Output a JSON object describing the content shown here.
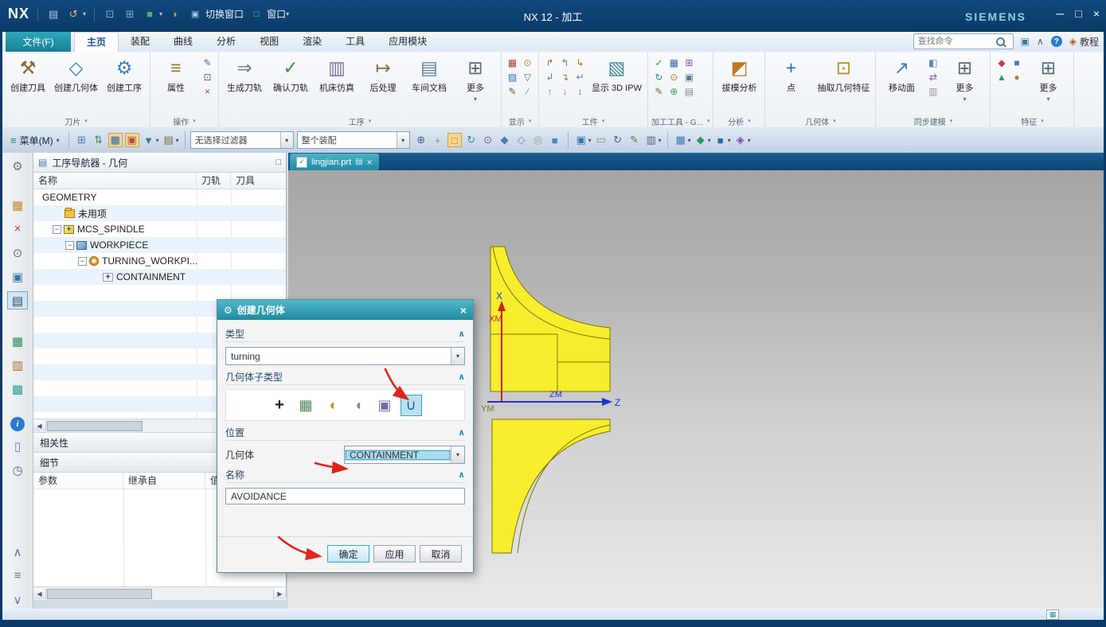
{
  "titlebar": {
    "logo": "NX",
    "switch_window": "切换窗口",
    "window_menu": "窗口",
    "title": "NX 12 - 加工",
    "brand": "SIEMENS"
  },
  "tabs": {
    "file": "文件(F)",
    "items": [
      "主页",
      "装配",
      "曲线",
      "分析",
      "视图",
      "渲染",
      "工具",
      "应用模块"
    ],
    "active_index": 0,
    "search_placeholder": "查找命令",
    "tutorial": "教程"
  },
  "ribbon": {
    "groups": [
      {
        "label": "刀片",
        "items": [
          {
            "kind": "lg",
            "name": "create-tool-button",
            "label": "创建刀具",
            "glyph": "⚒",
            "fg": "#8a6a3a"
          },
          {
            "kind": "lg",
            "name": "create-geometry-button",
            "label": "创建几何体",
            "glyph": "◇",
            "fg": "#2a7ab0"
          },
          {
            "kind": "lg",
            "name": "create-operation-button",
            "label": "创建工序",
            "glyph": "⚙",
            "fg": "#4a7ab0"
          }
        ]
      },
      {
        "label": "操作",
        "items": [
          {
            "kind": "lg",
            "name": "properties-button",
            "label": "属性",
            "glyph": "≡",
            "fg": "#9a7a30"
          },
          {
            "kind": "grid",
            "cols": 1,
            "icons": [
              {
                "name": "edit-operation-icon",
                "glyph": "✎",
                "fg": "#4a6a9a"
              },
              {
                "name": "copy-operation-icon",
                "glyph": "⊡",
                "fg": "#3a8a4a"
              },
              {
                "name": "delete-operation-icon",
                "glyph": "×",
                "fg": "#b04040"
              }
            ]
          }
        ]
      },
      {
        "label": "工序",
        "items": [
          {
            "kind": "lg",
            "name": "generate-toolpath-button",
            "label": "生成刀轨",
            "glyph": "⇒",
            "fg": "#6a7a8a"
          },
          {
            "kind": "lg",
            "name": "verify-toolpath-button",
            "label": "确认刀轨",
            "glyph": "✓",
            "fg": "#3a8a4a"
          },
          {
            "kind": "lg",
            "name": "machine-simulation-button",
            "label": "机床仿真",
            "glyph": "▥",
            "fg": "#7a6a9a"
          },
          {
            "kind": "lg",
            "name": "postprocess-button",
            "label": "后处理",
            "glyph": "↦",
            "fg": "#8a6a3a"
          },
          {
            "kind": "lg",
            "name": "shop-doc-button",
            "label": "车间文档",
            "glyph": "▤",
            "fg": "#5a7a9a"
          },
          {
            "kind": "lg",
            "name": "more-operation-button",
            "label": "更多",
            "glyph": "⊞",
            "fg": "#5a6a7a",
            "dd": true
          }
        ]
      },
      {
        "label": "显示",
        "items": [
          {
            "kind": "grid",
            "cols": 2,
            "icons": [
              {
                "name": "show-grid-icon",
                "glyph": "▦",
                "fg": "#b04040"
              },
              {
                "name": "show-wcs-icon",
                "glyph": "⊙",
                "fg": "#b08030"
              },
              {
                "name": "edit-display-icon",
                "glyph": "▨",
                "fg": "#3a6aa0"
              },
              {
                "name": "display-filter-icon",
                "glyph": "▽",
                "fg": "#3a7a8a"
              },
              {
                "name": "display-pen-icon",
                "glyph": "✎",
                "fg": "#6a5a3a"
              },
              {
                "name": "display-line-icon",
                "glyph": "∕",
                "fg": "#888888"
              }
            ]
          }
        ]
      },
      {
        "label": "工件",
        "items": [
          {
            "kind": "grid",
            "cols": 3,
            "icons": [
              {
                "name": "ipw-path-icon-1",
                "glyph": "↱",
                "fg": "#a08020"
              },
              {
                "name": "ipw-path-icon-2",
                "glyph": "↰",
                "fg": "#708090"
              },
              {
                "name": "ipw-path-icon-3",
                "glyph": "↳",
                "fg": "#a08020"
              },
              {
                "name": "ipw-path-icon-4",
                "glyph": "↲",
                "fg": "#708090"
              },
              {
                "name": "ipw-path-icon-5",
                "glyph": "↴",
                "fg": "#a08020"
              },
              {
                "name": "ipw-path-icon-6",
                "glyph": "↵",
                "fg": "#708090"
              },
              {
                "name": "ipw-path-icon-7",
                "glyph": "↑",
                "fg": "#708090"
              },
              {
                "name": "ipw-path-icon-8",
                "glyph": "↓",
                "fg": "#a08020"
              },
              {
                "name": "ipw-path-icon-9",
                "glyph": "↕",
                "fg": "#708090"
              }
            ]
          },
          {
            "kind": "lg",
            "name": "show-3d-ipw-button",
            "label": "显示 3D IPW",
            "glyph": "▧",
            "fg": "#3a8a9a"
          }
        ]
      },
      {
        "label": "加工工具 - G...",
        "items": [
          {
            "kind": "grid",
            "cols": 3,
            "icons": [
              {
                "name": "mw-check-icon",
                "glyph": "✓",
                "fg": "#2a9a3a"
              },
              {
                "name": "mw-grid-icon",
                "glyph": "▦",
                "fg": "#3a6aaa"
              },
              {
                "name": "mw-plus-icon",
                "glyph": "⊞",
                "fg": "#8a5aaa"
              },
              {
                "name": "mw-refresh-icon",
                "glyph": "↻",
                "fg": "#3a8a9a"
              },
              {
                "name": "mw-target-icon",
                "glyph": "⊙",
                "fg": "#aa7a2a"
              },
              {
                "name": "mw-box-icon",
                "glyph": "▣",
                "fg": "#5a7a9a"
              },
              {
                "name": "mw-pen-icon",
                "glyph": "✎",
                "fg": "#7a6a2a"
              },
              {
                "name": "mw-add-icon",
                "glyph": "⊕",
                "fg": "#3a9a6a"
              },
              {
                "name": "mw-doc-icon",
                "glyph": "▤",
                "fg": "#888888"
              }
            ]
          }
        ]
      },
      {
        "label": "分析",
        "items": [
          {
            "kind": "lg",
            "name": "draft-analysis-button",
            "label": "拔模分析",
            "glyph": "◩",
            "fg": "#c07820"
          }
        ]
      },
      {
        "label": "几何体",
        "items": [
          {
            "kind": "lg",
            "name": "point-button",
            "label": "点",
            "glyph": "+",
            "fg": "#2a6ab0"
          },
          {
            "kind": "lg",
            "name": "extract-geometry-button",
            "label": "抽取几何特征",
            "glyph": "⊡",
            "fg": "#b09020"
          }
        ]
      },
      {
        "label": "同步建模",
        "items": [
          {
            "kind": "lg",
            "name": "move-face-button",
            "label": "移动面",
            "glyph": "↗",
            "fg": "#3a7ab0"
          },
          {
            "kind": "grid",
            "cols": 1,
            "icons": [
              {
                "name": "sync-face-icon-1",
                "glyph": "◧",
                "fg": "#5a8aaa"
              },
              {
                "name": "sync-face-icon-2",
                "glyph": "⇄",
                "fg": "#7a5aaa"
              },
              {
                "name": "sync-face-icon-3",
                "glyph": "▥",
                "fg": "#999999"
              }
            ]
          },
          {
            "kind": "lg",
            "name": "more-sync-button",
            "label": "更多",
            "glyph": "⊞",
            "fg": "#5a6a7a",
            "dd": true
          }
        ]
      },
      {
        "label": "特征",
        "items": [
          {
            "kind": "grid",
            "cols": 2,
            "icons": [
              {
                "name": "feature-icon-1",
                "glyph": "◆",
                "fg": "#c04040"
              },
              {
                "name": "feature-icon-2",
                "glyph": "■",
                "fg": "#4a7ab0"
              },
              {
                "name": "feature-icon-3",
                "glyph": "▲",
                "fg": "#3a9a5a"
              },
              {
                "name": "feature-icon-4",
                "glyph": "●",
                "fg": "#b08030"
              }
            ]
          },
          {
            "kind": "lg",
            "name": "more-feature-button",
            "label": "更多",
            "glyph": "⊞",
            "fg": "#5a6a7a",
            "dd": true
          }
        ]
      }
    ]
  },
  "toolbar": {
    "menu_label": "菜单(M)",
    "filter_value": "无选择过滤器",
    "scope_value": "整个装配",
    "icons_a": [
      {
        "name": "select-dot-icon",
        "glyph": "⊞",
        "fg": "#4a7ab0"
      },
      {
        "name": "select-swap-icon",
        "glyph": "⇅",
        "fg": "#3a8a5a"
      },
      {
        "name": "highlight-toggle-icon",
        "glyph": "▦",
        "fg": "#2a6ab0",
        "active": true
      },
      {
        "name": "snap-toggle-icon",
        "glyph": "▣",
        "fg": "#b05030",
        "active": true
      },
      {
        "name": "wcs-menu-icon",
        "glyph": "▼",
        "fg": "#3a7a9a",
        "dd": true
      },
      {
        "name": "layer-menu-icon",
        "glyph": "▤",
        "fg": "#7a6a3a",
        "dd": true
      }
    ],
    "icons_b": [
      {
        "name": "fit-view-icon",
        "glyph": "⊕",
        "fg": "#3a6a9a"
      },
      {
        "name": "pan-icon",
        "glyph": "+",
        "fg": "#888888"
      },
      {
        "name": "select-box-icon",
        "glyph": "□",
        "fg": "#c07820",
        "active": true
      },
      {
        "name": "rotate-view-icon",
        "glyph": "↻",
        "fg": "#3a8a9a"
      },
      {
        "name": "zoom-icon",
        "glyph": "⊙",
        "fg": "#7a5aa0"
      },
      {
        "name": "shaded-view-icon",
        "glyph": "◆",
        "fg": "#4a7ab0"
      },
      {
        "name": "wireframe-view-icon",
        "glyph": "◇",
        "fg": "#888888"
      },
      {
        "name": "snap-point-icon",
        "glyph": "◎",
        "fg": "#999999"
      },
      {
        "name": "view-cube-icon",
        "glyph": "■",
        "fg": "#4a88c0"
      }
    ],
    "icons_c": [
      {
        "name": "window-view-icon",
        "glyph": "▣",
        "fg": "#2a7ab0",
        "dd": true
      },
      {
        "name": "flat-view-icon",
        "glyph": "▭",
        "fg": "#888888"
      },
      {
        "name": "refresh-view-icon",
        "glyph": "↻",
        "fg": "#556677"
      },
      {
        "name": "sketch-icon",
        "glyph": "✎",
        "fg": "#7a6a30"
      },
      {
        "name": "grid-menu-icon",
        "glyph": "▥",
        "fg": "#556677",
        "dd": true
      }
    ],
    "icons_d": [
      {
        "name": "table-menu-icon",
        "glyph": "▦",
        "fg": "#3a7ab0",
        "dd": true
      },
      {
        "name": "layers-menu-icon",
        "glyph": "◆",
        "fg": "#2a9a6a",
        "dd": true
      },
      {
        "name": "solid-menu-icon",
        "glyph": "■",
        "fg": "#2a6ab0",
        "dd": true
      },
      {
        "name": "effects-menu-icon",
        "glyph": "◈",
        "fg": "#7a4ab0",
        "dd": true
      }
    ]
  },
  "resourcebar": {
    "items": [
      {
        "name": "roles-gear-icon",
        "glyph": "⚙",
        "fg": "#667788"
      },
      {
        "gap": 12
      },
      {
        "name": "assembly-navigator-icon",
        "glyph": "▦",
        "fg": "#c08828"
      },
      {
        "name": "constraint-navigator-icon",
        "glyph": "×",
        "fg": "#b04040"
      },
      {
        "name": "part-navigator-icon",
        "glyph": "⊙",
        "fg": "#4a70a0"
      },
      {
        "name": "reuse-library-icon",
        "glyph": "▣",
        "fg": "#3a78b0"
      },
      {
        "name": "operation-navigator-icon",
        "glyph": "▤",
        "fg": "#334455",
        "active": true
      },
      {
        "gap": 14
      },
      {
        "name": "machine-tool-navigator-icon",
        "glyph": "▦",
        "fg": "#2a8a5a"
      },
      {
        "name": "process-assistant-icon",
        "glyph": "▥",
        "fg": "#b06828"
      },
      {
        "name": "template-library-icon",
        "glyph": "▩",
        "fg": "#2a9a9a"
      },
      {
        "gap": 10
      },
      {
        "name": "info-icon",
        "glyph": "i",
        "fg": "#ffffff",
        "bg": "#2a7ad0",
        "round": true
      },
      {
        "name": "internet-doc-icon",
        "glyph": "▯",
        "fg": "#4a88c8"
      },
      {
        "name": "history-icon",
        "glyph": "◷",
        "fg": "#556677"
      },
      {
        "flex": true
      },
      {
        "name": "panel-collapse-up-icon",
        "glyph": "∧",
        "fg": "#667788"
      },
      {
        "name": "panel-pin-icon",
        "glyph": "≡",
        "fg": "#667788"
      },
      {
        "name": "panel-collapse-down-icon",
        "glyph": "∨",
        "fg": "#667788"
      }
    ]
  },
  "navigator": {
    "title": "工序导航器 - 几何",
    "columns": [
      "名称",
      "刀轨",
      "刀具"
    ],
    "rows": [
      {
        "label": "GEOMETRY",
        "indent": 0,
        "icon": "none",
        "expander": ""
      },
      {
        "label": "未用项",
        "indent": 1,
        "icon": "folder",
        "expander": ""
      },
      {
        "label": "MCS_SPINDLE",
        "indent": 1,
        "icon": "mcs",
        "expander": "minus"
      },
      {
        "label": "WORKPIECE",
        "indent": 2,
        "icon": "workpiece",
        "expander": "minus"
      },
      {
        "label": "TURNING_WORKPI...",
        "indent": 3,
        "icon": "turning",
        "expander": "minus"
      },
      {
        "label": "CONTAINMENT",
        "indent": 4,
        "icon": "containment",
        "expander": ""
      }
    ],
    "dependencies_label": "相关性",
    "details_label": "细节",
    "details_columns": [
      "参数",
      "继承自",
      "值"
    ]
  },
  "dialog": {
    "title": "创建几何体",
    "type_label": "类型",
    "type_value": "turning",
    "subtype_label": "几何体子类型",
    "location_label": "位置",
    "geometry_label": "几何体",
    "geometry_value": "CONTAINMENT",
    "name_label": "名称",
    "name_value": "AVOIDANCE",
    "ok": "确定",
    "apply": "应用",
    "cancel": "取消",
    "subtype_icons": [
      {
        "name": "mcs-subtype-icon",
        "glyph": "+",
        "fg": "#222222"
      },
      {
        "name": "workpiece-subtype-icon",
        "glyph": "▦",
        "fg": "#4a8a5a"
      },
      {
        "name": "turn-boundary-subtype-icon",
        "glyph": "◖",
        "fg": "#c09020"
      },
      {
        "name": "turn-part-subtype-icon",
        "glyph": "◖",
        "fg": "#8a8a8a"
      },
      {
        "name": "sequence-subtype-icon",
        "glyph": "▣",
        "fg": "#7a6aa0"
      },
      {
        "name": "avoidance-subtype-icon",
        "glyph": "∪",
        "fg": "#1f5fae",
        "selected": true
      }
    ]
  },
  "viewport": {
    "tab": "lingjian.prt",
    "labels": {
      "x": "X",
      "xm": "XM",
      "ym": "YM",
      "zm": "ZM",
      "z": "Z"
    }
  }
}
